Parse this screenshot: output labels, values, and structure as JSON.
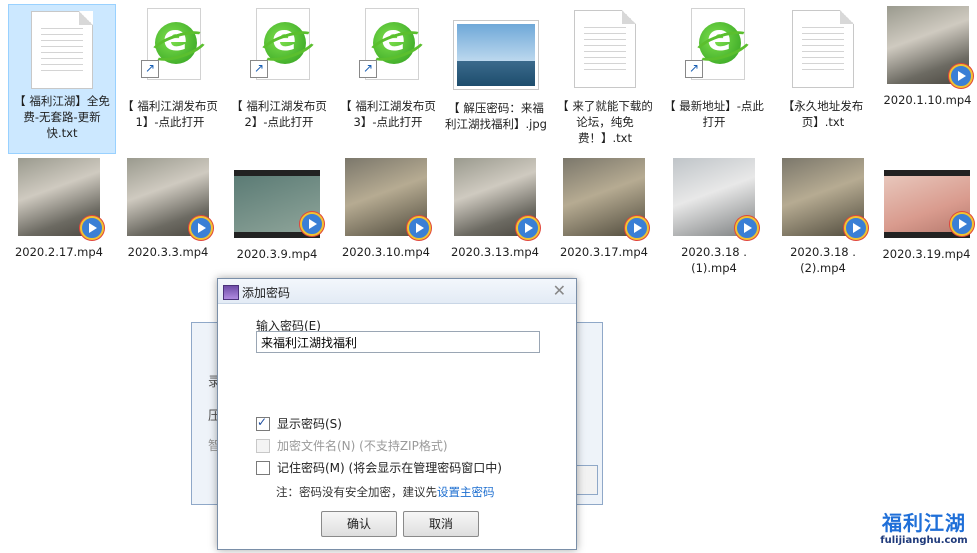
{
  "files_row1": [
    {
      "type": "txt-selected",
      "label": "【 福利江湖】全免费-无套路-更新快.txt"
    },
    {
      "type": "ie",
      "label": "【 福利江湖发布页1】-点此打开"
    },
    {
      "type": "ie",
      "label": "【 福利江湖发布页2】-点此打开"
    },
    {
      "type": "ie",
      "label": "【 福利江湖发布页3】-点此打开"
    },
    {
      "type": "jpg",
      "label": "【 解压密码：来福利江湖找福利】.jpg"
    },
    {
      "type": "txt",
      "label": "【 来了就能下载的论坛，纯免费！】.txt"
    },
    {
      "type": "ie",
      "label": "【 最新地址】-点此打开"
    },
    {
      "type": "txt",
      "label": "【永久地址发布页】.txt"
    },
    {
      "type": "video",
      "label": "2020.1.10.mp4"
    }
  ],
  "files_row2": [
    {
      "type": "video",
      "label": "2020.2.17.mp4"
    },
    {
      "type": "video",
      "label": "2020.3.3.mp4"
    },
    {
      "type": "video-strip",
      "label": "2020.3.9.mp4"
    },
    {
      "type": "video",
      "label": "2020.3.10.mp4"
    },
    {
      "type": "video",
      "label": "2020.3.13.mp4"
    },
    {
      "type": "video",
      "label": "2020.3.17.mp4"
    },
    {
      "type": "video",
      "label": "2020.3.18 .(1).mp4"
    },
    {
      "type": "video",
      "label": "2020.3.18 .(2).mp4"
    },
    {
      "type": "video-strip",
      "label": "2020.3.19.mp4"
    }
  ],
  "background_window": {
    "ghost_chars": [
      "录",
      "压",
      "智"
    ]
  },
  "dialog": {
    "title": "添加密码",
    "close_glyph": "✕",
    "password_label": "输入密码(E)",
    "password_value": "来福利江湖找福利",
    "options": [
      {
        "label": "显示密码(S)",
        "checked": true,
        "disabled": false
      },
      {
        "label": "加密文件名(N) (不支持ZIP格式)",
        "checked": false,
        "disabled": true
      },
      {
        "label": "记住密码(M) (将会显示在管理密码窗口中)",
        "checked": false,
        "disabled": false
      }
    ],
    "note_text": "注：密码没有安全加密，建议先",
    "note_link": "设置主密码",
    "ok_label": "确认",
    "cancel_label": "取消"
  },
  "watermark": {
    "text": "福利江湖",
    "url": "fulijianghu.com"
  }
}
